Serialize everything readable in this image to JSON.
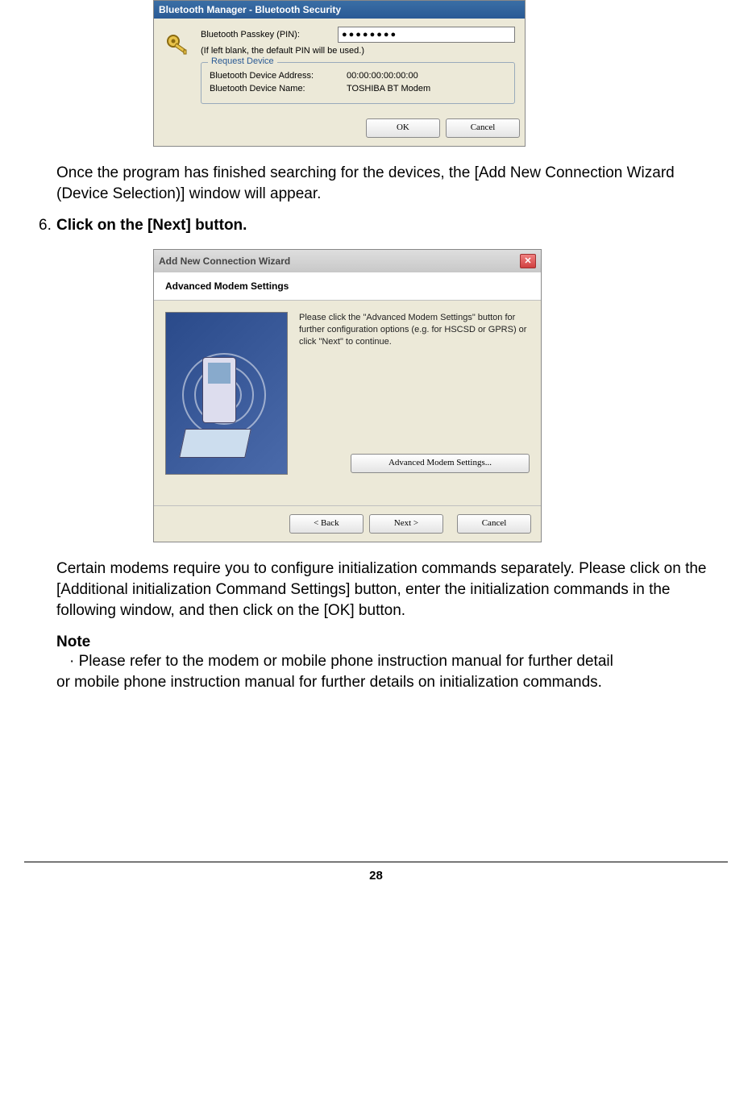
{
  "dlg1": {
    "title": "Bluetooth Manager  - Bluetooth Security",
    "pin_label": "Bluetooth Passkey (PIN):",
    "pin_value": "●●●●●●●●",
    "hint": "(If left blank, the default PIN will be used.)",
    "group_title": "Request Device",
    "addr_label": "Bluetooth Device Address:",
    "addr_value": "00:00:00:00:00:00",
    "name_label": "Bluetooth Device Name:",
    "name_value": "TOSHIBA BT Modem",
    "ok": "OK",
    "cancel": "Cancel"
  },
  "para1": "Once the program has finished searching for the devices, the [Add New Connection Wizard (Device Selection)] window will appear.",
  "step6_num": "6.",
  "step6_text": "Click on the [Next] button.",
  "dlg2": {
    "title": "Add New Connection Wizard",
    "subheader": "Advanced Modem Settings",
    "instructions": "Please click the \"Advanced Modem Settings\" button for further configuration options (e.g. for HSCSD or GPRS) or click \"Next\" to continue.",
    "adv_btn": "Advanced Modem Settings...",
    "back": "< Back",
    "next": "Next >",
    "cancel": "Cancel"
  },
  "para2": "Certain modems require you to configure initialization commands separately. Please click on the [Additional initialization Command Settings] button, enter the initialization commands in the following window, and then click on the [OK] button.",
  "note_heading": "Note",
  "note_bullet": "Please refer to the modem or mobile phone instruction manual for further detail",
  "note_cont": "or mobile phone instruction manual for further details on initialization commands.",
  "page_number": "28"
}
